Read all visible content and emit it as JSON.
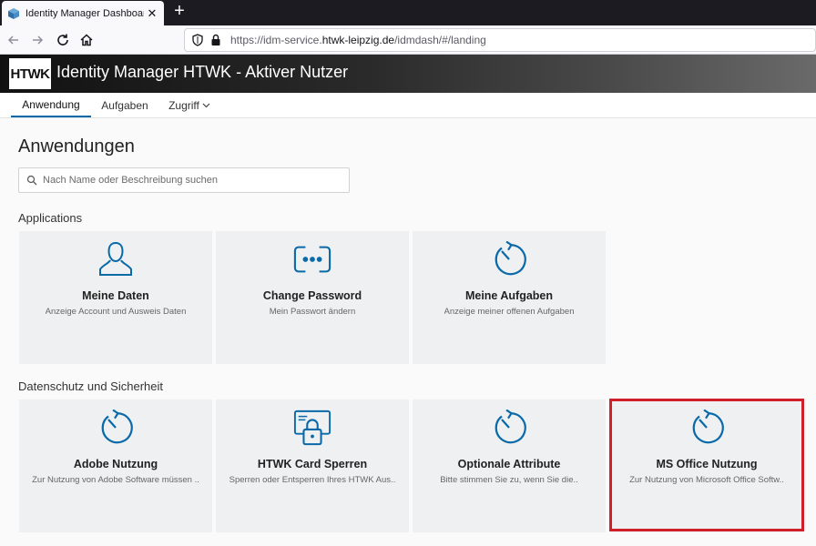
{
  "browser": {
    "tab_title": "Identity Manager Dashboard",
    "url_prefix": "https://idm-service.",
    "url_host": "htwk-leipzig.de",
    "url_path": "/idmdash/#/landing"
  },
  "header": {
    "logo_text": "HTWK",
    "title": "Identity Manager HTWK - Aktiver Nutzer"
  },
  "tabs": [
    {
      "label": "Anwendung"
    },
    {
      "label": "Aufgaben"
    },
    {
      "label": "Zugriff"
    }
  ],
  "main": {
    "title": "Anwendungen",
    "search_placeholder": "Nach Name oder Beschreibung suchen"
  },
  "sections": [
    {
      "title": "Applications",
      "cards": [
        {
          "title": "Meine Daten",
          "desc": "Anzeige Account und Ausweis Daten",
          "icon": "user-icon"
        },
        {
          "title": "Change Password",
          "desc": "Mein Passwort ändern",
          "icon": "password-icon"
        },
        {
          "title": "Meine Aufgaben",
          "desc": "Anzeige meiner offenen Aufgaben",
          "icon": "circular-arrow-icon"
        }
      ]
    },
    {
      "title": "Datenschutz und Sicherheit",
      "cards": [
        {
          "title": "Adobe Nutzung",
          "desc": "Zur Nutzung von Adobe Software müssen ..",
          "icon": "circular-arrow-icon"
        },
        {
          "title": "HTWK Card Sperren",
          "desc": "Sperren oder Entsperren Ihres HTWK Aus..",
          "icon": "card-lock-icon"
        },
        {
          "title": "Optionale Attribute",
          "desc": "Bitte stimmen Sie zu, wenn Sie die..",
          "icon": "circular-arrow-icon"
        },
        {
          "title": "MS Office Nutzung",
          "desc": "Zur Nutzung von Microsoft Office Softw..",
          "icon": "circular-arrow-icon"
        }
      ]
    }
  ],
  "colors": {
    "accent": "#0a6aa9",
    "highlight": "#d11f2a"
  }
}
